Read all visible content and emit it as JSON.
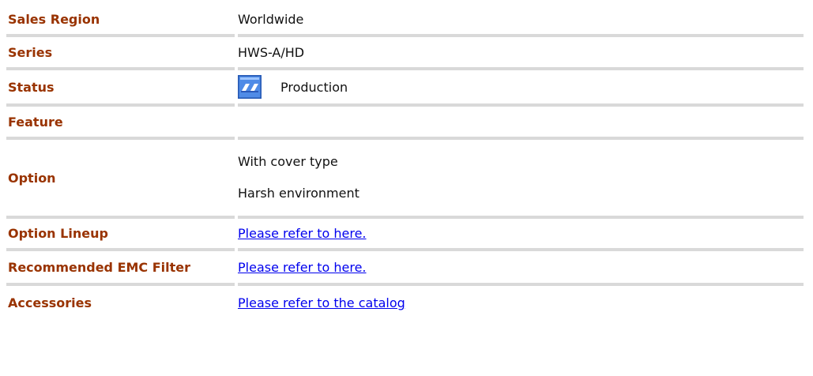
{
  "rows": {
    "sales_region": {
      "label": "Sales Region",
      "value": "Worldwide"
    },
    "series": {
      "label": "Series",
      "value": "HWS-A/HD"
    },
    "status": {
      "label": "Status",
      "value": "Production",
      "icon": "production-status-icon"
    },
    "feature": {
      "label": "Feature",
      "value": ""
    },
    "option": {
      "label": "Option",
      "values": [
        "With cover type",
        "Harsh environment"
      ]
    },
    "option_lineup": {
      "label": "Option Lineup",
      "link": "Please refer to here."
    },
    "emc_filter": {
      "label": "Recommended EMC Filter",
      "link": "Please refer to here."
    },
    "accessories": {
      "label": "Accessories",
      "link": "Please refer to the catalog"
    }
  },
  "colors": {
    "label_text": "#993300",
    "row_divider": "#d9d9d9",
    "link": "#0000ee",
    "icon_blue": "#2f66c7"
  }
}
